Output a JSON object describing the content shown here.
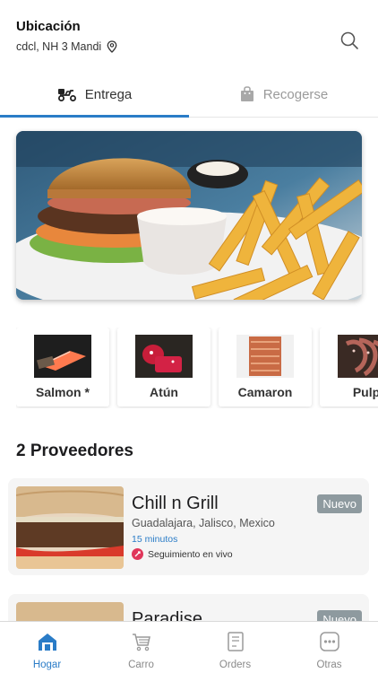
{
  "header": {
    "location_title": "Ubicación",
    "location_address": "cdcl, NH 3 Mandi",
    "icons": {
      "location": "map-pin-icon",
      "search": "search-icon"
    }
  },
  "tabs": [
    {
      "label": "Entrega",
      "icon": "scooter-icon",
      "active": true
    },
    {
      "label": "Recogerse",
      "icon": "shopping-bag-icon",
      "active": false
    }
  ],
  "banner": {
    "subject": "burger-and-fries"
  },
  "categories": [
    {
      "label": "Salmon *"
    },
    {
      "label": "Atún"
    },
    {
      "label": "Camaron"
    },
    {
      "label": "Pulp"
    }
  ],
  "providers_section": {
    "title": "2 Proveedores"
  },
  "providers": [
    {
      "name": "Chill n Grill",
      "address": "Guadalajara, Jalisco, Mexico",
      "time": "15  minutos",
      "tracking": "Seguimiento en vivo",
      "badge": "Nuevo"
    },
    {
      "name": "Paradise",
      "badge": "Nuevo"
    }
  ],
  "bottom_nav": [
    {
      "label": "Hogar",
      "icon": "home-icon",
      "active": true
    },
    {
      "label": "Carro",
      "icon": "cart-icon",
      "active": false
    },
    {
      "label": "Orders",
      "icon": "orders-icon",
      "active": false
    },
    {
      "label": "Otras",
      "icon": "more-icon",
      "active": false
    }
  ],
  "colors": {
    "accent": "#2a7cc7",
    "badge": "#8e9a9f",
    "tracking_icon": "#e0365a",
    "card_bg": "#f5f5f5"
  }
}
